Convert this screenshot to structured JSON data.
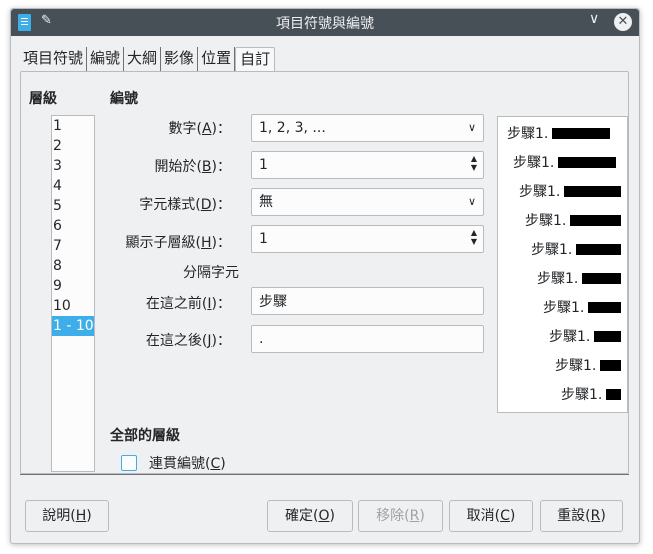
{
  "window": {
    "title": "項目符號與編號",
    "pin_glyph": "✎",
    "minimize_glyph": "∨",
    "close_glyph": "✕"
  },
  "tabs": [
    "項目符號",
    "編號",
    "大綱",
    "影像",
    "位置",
    "自訂"
  ],
  "active_tab": "自訂",
  "level_section": {
    "label": "層級",
    "items": [
      "1",
      "2",
      "3",
      "4",
      "5",
      "6",
      "7",
      "8",
      "9",
      "10",
      "1 - 10"
    ],
    "selected": "1 - 10"
  },
  "numbering_section": {
    "label": "編號",
    "number_label": "數字(",
    "number_key": "A",
    "number_value": "1, 2, 3, ...",
    "start_label": "開始於(",
    "start_key": "B",
    "start_value": "1",
    "charstyle_label": "字元樣式(",
    "charstyle_key": "D",
    "charstyle_value": "無",
    "sublevels_label": "顯示子層級(",
    "sublevels_key": "H",
    "sublevels_value": "1",
    "separator_heading": "分隔字元",
    "before_label": "在這之前(",
    "before_key": "I",
    "before_value": "步驟",
    "after_label": "在這之後(",
    "after_key": "J",
    "after_value": ".",
    "label_suffix": ")："
  },
  "preview": {
    "row_text": "步驟1."
  },
  "all_levels": {
    "label": "全部的層級",
    "consecutive_label": "連貫編號(",
    "consecutive_key": "C",
    "consecutive_suffix": ")",
    "checked": false
  },
  "buttons": {
    "help": {
      "label": "說明(",
      "key": "H",
      "suffix": ")"
    },
    "ok": {
      "label": "確定(",
      "key": "O",
      "suffix": ")"
    },
    "remove": {
      "label": "移除(",
      "key": "R",
      "suffix": ")",
      "disabled": true
    },
    "cancel": {
      "label": "取消(",
      "key": "C",
      "suffix": ")"
    },
    "reset": {
      "label": "重設(",
      "key": "R",
      "suffix": ")"
    }
  },
  "colors": {
    "titlebar": "#475057",
    "accent": "#3daee9",
    "window_bg": "#eff0f1"
  }
}
